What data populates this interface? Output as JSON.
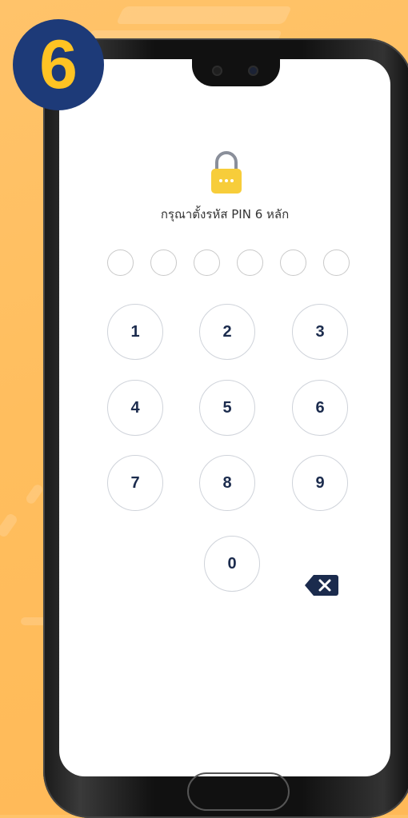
{
  "step_badge": {
    "number": "6"
  },
  "screen": {
    "title": "กรุณาตั้งรหัส PIN 6 หลัก",
    "pin_length": 6,
    "keypad": {
      "keys": [
        "1",
        "2",
        "3",
        "4",
        "5",
        "6",
        "7",
        "8",
        "9",
        "0"
      ],
      "delete_icon": "backspace-icon"
    },
    "lock_icon": "lock-icon"
  },
  "colors": {
    "background": "#ffbe5e",
    "badge_bg": "#1d3a78",
    "badge_text": "#ffc323",
    "lock_yellow": "#f7cd3a",
    "key_text": "#1b2b4d",
    "backspace": "#1b2b4d"
  }
}
